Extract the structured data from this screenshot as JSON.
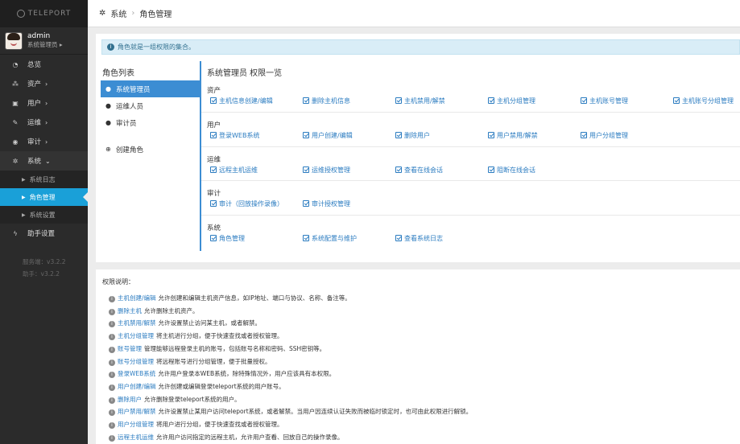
{
  "app": {
    "logo_text": "TELEPORT"
  },
  "user": {
    "name": "admin",
    "role": "系统管理员 ▸"
  },
  "nav": {
    "overview": "总览",
    "assets": "资产",
    "users": "用户",
    "ops": "运维",
    "audit": "审计",
    "system": "系统",
    "system_log": "系统日志",
    "role_mgmt": "角色管理",
    "system_settings": "系统设置",
    "assistant_settings": "助手设置",
    "server_version": "服务端：v3.2.2",
    "assistant_version": "助手：v3.2.2"
  },
  "breadcrumb": {
    "root": "系统",
    "current": "角色管理"
  },
  "alert": {
    "text": "角色就是一组权限的集合。"
  },
  "roles": {
    "title": "角色列表",
    "items": [
      "系统管理员",
      "运维人员",
      "审计员"
    ],
    "create": "创建角色"
  },
  "permissions": {
    "title": "系统管理员 权限一览",
    "groups": [
      {
        "name": "资产",
        "items": [
          "主机信息创建/编辑",
          "删除主机信息",
          "主机禁用/解禁",
          "主机分组管理",
          "主机账号管理",
          "主机账号分组管理"
        ]
      },
      {
        "name": "用户",
        "items": [
          "登录WEB系统",
          "用户创建/编辑",
          "删除用户",
          "用户禁用/解禁",
          "用户分组管理"
        ]
      },
      {
        "name": "运维",
        "items": [
          "远程主机运维",
          "运维授权管理",
          "查看在线会话",
          "阻断在线会话"
        ]
      },
      {
        "name": "审计",
        "items": [
          "审计（回放操作录像）",
          "审计授权管理"
        ]
      },
      {
        "name": "系统",
        "items": [
          "角色管理",
          "系统配置与维护",
          "查看系统日志"
        ]
      }
    ]
  },
  "notes": {
    "title": "权限说明：",
    "items": [
      {
        "term": "主机创建/编辑",
        "desc": "允许创建和编辑主机资产信息，如IP地址、端口与协议、名称、备注等。"
      },
      {
        "term": "删除主机",
        "desc": "允许删除主机资产。"
      },
      {
        "term": "主机禁用/解禁",
        "desc": "允许设置禁止访问某主机，或者解禁。"
      },
      {
        "term": "主机分组管理",
        "desc": "将主机进行分组，便于快速查找或者授权管理。"
      },
      {
        "term": "账号管理",
        "desc": "管理能够远程登录主机的账号，包括账号名称和密码、SSH密钥等。"
      },
      {
        "term": "账号分组管理",
        "desc": "将远程账号进行分组管理，便于批量授权。"
      },
      {
        "term": "登录WEB系统",
        "desc": "允许用户登录本WEB系统，除特殊情况外，用户应该具有本权限。"
      },
      {
        "term": "用户创建/编辑",
        "desc": "允许创建或编辑登录teleport系统的用户账号。"
      },
      {
        "term": "删除用户",
        "desc": "允许删除登录teleport系统的用户。"
      },
      {
        "term": "用户禁用/解禁",
        "desc": "允许设置禁止某用户访问teleport系统，或者解禁。当用户因连续认证失败而被临时锁定时，也可由此权限进行解锁。"
      },
      {
        "term": "用户分组管理",
        "desc": "将用户进行分组，便于快速查找或者授权管理。"
      },
      {
        "term": "远程主机运维",
        "desc": "允许用户访问指定的远程主机，允许用户查看、回放自己的操作录像。"
      }
    ]
  }
}
